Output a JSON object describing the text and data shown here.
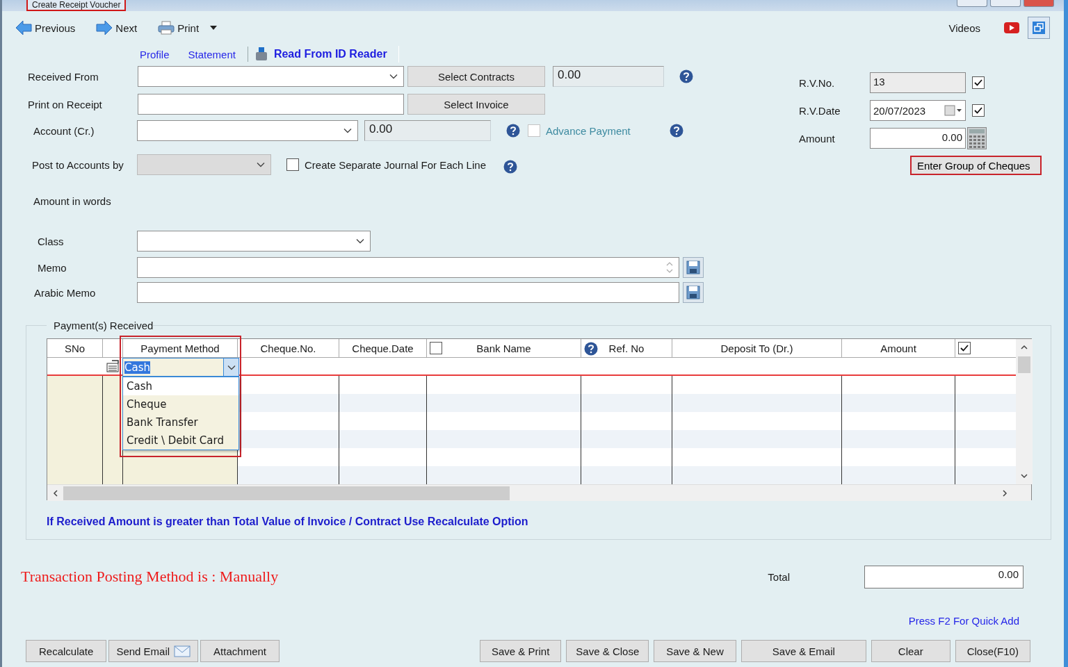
{
  "window": {
    "title": "Create Receipt Voucher"
  },
  "toolbar": {
    "buttons": [
      {
        "kind": "previous",
        "label": "Previous"
      },
      {
        "kind": "next",
        "label": "Next"
      },
      {
        "kind": "print",
        "label": "Print"
      }
    ],
    "videos": "Videos"
  },
  "links": [
    {
      "kind": "link",
      "label": "Profile"
    },
    {
      "kind": "link",
      "label": "Statement"
    },
    {
      "kind": "reader",
      "label": "Read From ID Reader"
    }
  ],
  "form": {
    "received_from": {
      "label": "Received From"
    },
    "select_contracts": "Select Contracts",
    "contracts_total": "0.00",
    "print_on_receipt": {
      "label": "Print on Receipt"
    },
    "select_invoice": "Select Invoice",
    "account": {
      "label": "Account (Cr.)",
      "balance": "0.00"
    },
    "advance_payment": {
      "label": "Advance Payment",
      "checked": false,
      "disabled": true
    },
    "post_to_accounts": {
      "label": "Post to Accounts by",
      "disabled": true
    },
    "separate_journal": {
      "label": "Create Separate Journal For Each Line",
      "checked": false
    },
    "amount_in_words": {
      "label": "Amount in words"
    },
    "class": {
      "label": "Class"
    },
    "memo": {
      "label": "Memo"
    },
    "arabic_memo": {
      "label": "Arabic Memo"
    }
  },
  "voucher": {
    "rv_no": {
      "label": "R.V.No.",
      "value": "13",
      "checked": true
    },
    "rv_date": {
      "label": "R.V.Date",
      "value": "20/07/2023",
      "checked": true
    },
    "amount": {
      "label": "Amount",
      "value": "0.00"
    },
    "group_cheques": "Enter Group of Cheques"
  },
  "payments": {
    "title": "Payment(s) Received",
    "columns": [
      {
        "kind": "text",
        "label": "SNo"
      },
      {
        "kind": "blank"
      },
      {
        "kind": "text",
        "label": "Payment Method"
      },
      {
        "kind": "text",
        "label": "Cheque.No."
      },
      {
        "kind": "text",
        "label": "Cheque.Date"
      },
      {
        "kind": "check_text",
        "label": "Bank Name",
        "checked": false
      },
      {
        "kind": "help_text",
        "label": "Ref. No"
      },
      {
        "kind": "text",
        "label": "Deposit To (Dr.)"
      },
      {
        "kind": "text",
        "label": "Amount"
      },
      {
        "kind": "check",
        "checked": true
      }
    ],
    "dropdown": {
      "value": "Cash",
      "options": [
        {
          "label": "Cash",
          "selected": true
        },
        {
          "label": "Cheque",
          "selected": false
        },
        {
          "label": "Bank Transfer",
          "selected": false
        },
        {
          "label": "Credit \\ Debit Card",
          "selected": false
        }
      ]
    },
    "note": "If Received Amount is greater than Total Value of Invoice / Contract Use Recalculate Option"
  },
  "posting_method": "Transaction Posting Method is : Manually",
  "total": {
    "label": "Total",
    "value": "0.00"
  },
  "quick_add": "Press F2 For Quick Add",
  "buttons_left": [
    {
      "kind": "plain",
      "label": "Recalculate"
    },
    {
      "kind": "email",
      "label": "Send Email"
    },
    {
      "kind": "plain",
      "label": "Attachment"
    }
  ],
  "buttons_right": [
    "Save & Print",
    "Save & Close",
    "Save & New",
    "Save & Email",
    "Clear",
    "Close(F10)"
  ]
}
